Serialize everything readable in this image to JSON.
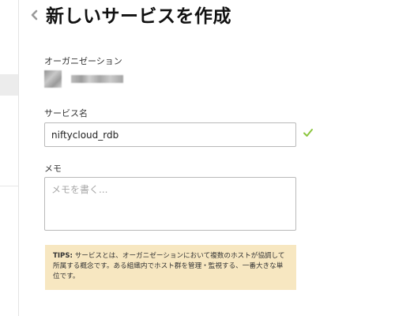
{
  "page": {
    "title": "新しいサービスを作成",
    "back_icon": "chevron-left-icon"
  },
  "organization": {
    "label": "オーガニゼーション",
    "name": "system"
  },
  "service_name": {
    "label": "サービス名",
    "value": "niftycloud_rdb",
    "valid_icon": "checkmark-icon",
    "valid_color": "#8cc63f"
  },
  "memo": {
    "label": "メモ",
    "placeholder": "メモを書く...",
    "value": ""
  },
  "tips": {
    "prefix": "TIPS:",
    "text": " サービスとは、オーガニゼーションにおいて複数のホストが協調して所属する概念です。ある組織内でホスト群を管理・監視する、一番大きな単位です。",
    "background": "#f7e7c1"
  }
}
